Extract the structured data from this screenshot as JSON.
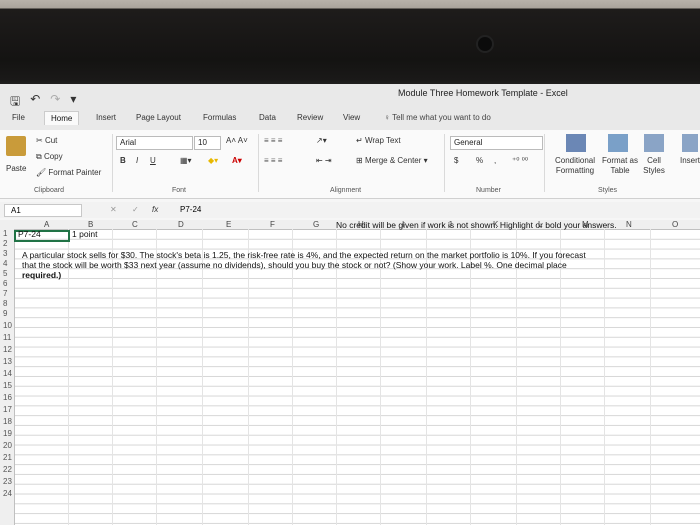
{
  "window": {
    "title": "Module Three Homework Template  -  Excel"
  },
  "tabs": [
    "File",
    "Home",
    "Insert",
    "Page Layout",
    "Formulas",
    "Data",
    "Review",
    "View"
  ],
  "active_tab": "Home",
  "tell_me": "Tell me what you want to do",
  "clipboard": {
    "cut": "Cut",
    "copy": "Copy",
    "paste": "Paste",
    "format_painter": "Format Painter",
    "group": "Clipboard"
  },
  "font": {
    "name": "Arial",
    "size": "10",
    "group": "Font",
    "bold": "B",
    "italic": "I",
    "underline": "U"
  },
  "alignment": {
    "wrap": "Wrap Text",
    "merge": "Merge & Center",
    "group": "Alignment"
  },
  "number": {
    "format": "General",
    "currency": "$",
    "percent": "%",
    "comma": ",",
    "group": "Number"
  },
  "styles": {
    "conditional": "Conditional Formatting",
    "format_table": "Format as Table",
    "cell_styles": "Cell Styles",
    "group": "Styles",
    "insert": "Insert"
  },
  "formula_bar": {
    "name_box": "A1",
    "fx": "fx",
    "content": "P7-24"
  },
  "columns": [
    "A",
    "B",
    "C",
    "D",
    "E",
    "F",
    "G",
    "H",
    "I",
    "J",
    "K",
    "L",
    "M",
    "N",
    "O"
  ],
  "rows": [
    "1",
    "2",
    "3",
    "4",
    "5",
    "6",
    "7",
    "8",
    "9",
    "10",
    "11",
    "12",
    "13",
    "14",
    "15",
    "16",
    "17",
    "18",
    "19",
    "20",
    "21",
    "22",
    "23",
    "24"
  ],
  "cells": {
    "a1": "P7-24",
    "b1": "1 point",
    "h1": "No credit will be given if work is not shown.  Highlight or bold your answers.",
    "a3": "A particular stock sells for $30.  The stock's beta is 1.25, the risk-free rate is 4%, and the expected return on the market portfolio is 10%.  If you forecast",
    "a4": "that the stock will be worth $33 next year (assume no dividends), should you buy the stock or not?  (Show your work.  Label %.  One decimal place",
    "a5": "required.)"
  }
}
